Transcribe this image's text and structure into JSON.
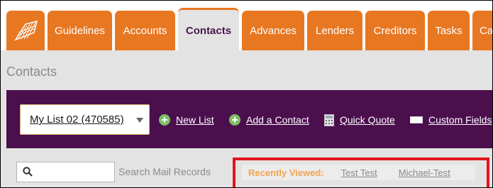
{
  "tabs": [
    {
      "label": ""
    },
    {
      "label": "Guidelines"
    },
    {
      "label": "Accounts"
    },
    {
      "label": "Contacts"
    },
    {
      "label": "Advances"
    },
    {
      "label": "Lenders"
    },
    {
      "label": "Creditors"
    },
    {
      "label": "Tasks"
    },
    {
      "label": "Ca"
    }
  ],
  "page": {
    "title": "Contacts"
  },
  "toolbar": {
    "list_select_value": "My List 02 (470585)",
    "new_list": "New List",
    "add_contact": "Add a Contact",
    "quick_quote": "Quick Quote",
    "custom_fields": "Custom Fields"
  },
  "search": {
    "placeholder": "",
    "label": "Search Mail Records"
  },
  "recently_viewed": {
    "label": "Recently Viewed:",
    "items": [
      "Test Test",
      "Michael-Test"
    ]
  },
  "colors": {
    "tab_orange": "#e87722",
    "active_tab_text": "#4a1a4e",
    "toolbar_purple": "#4b0f4e",
    "highlight_red": "#e2141c",
    "recent_label": "#f3a44a"
  },
  "icons": [
    "logo-icon",
    "plus-circle-icon",
    "calculator-icon",
    "fields-icon",
    "search-icon",
    "dropdown-caret-icon"
  ]
}
